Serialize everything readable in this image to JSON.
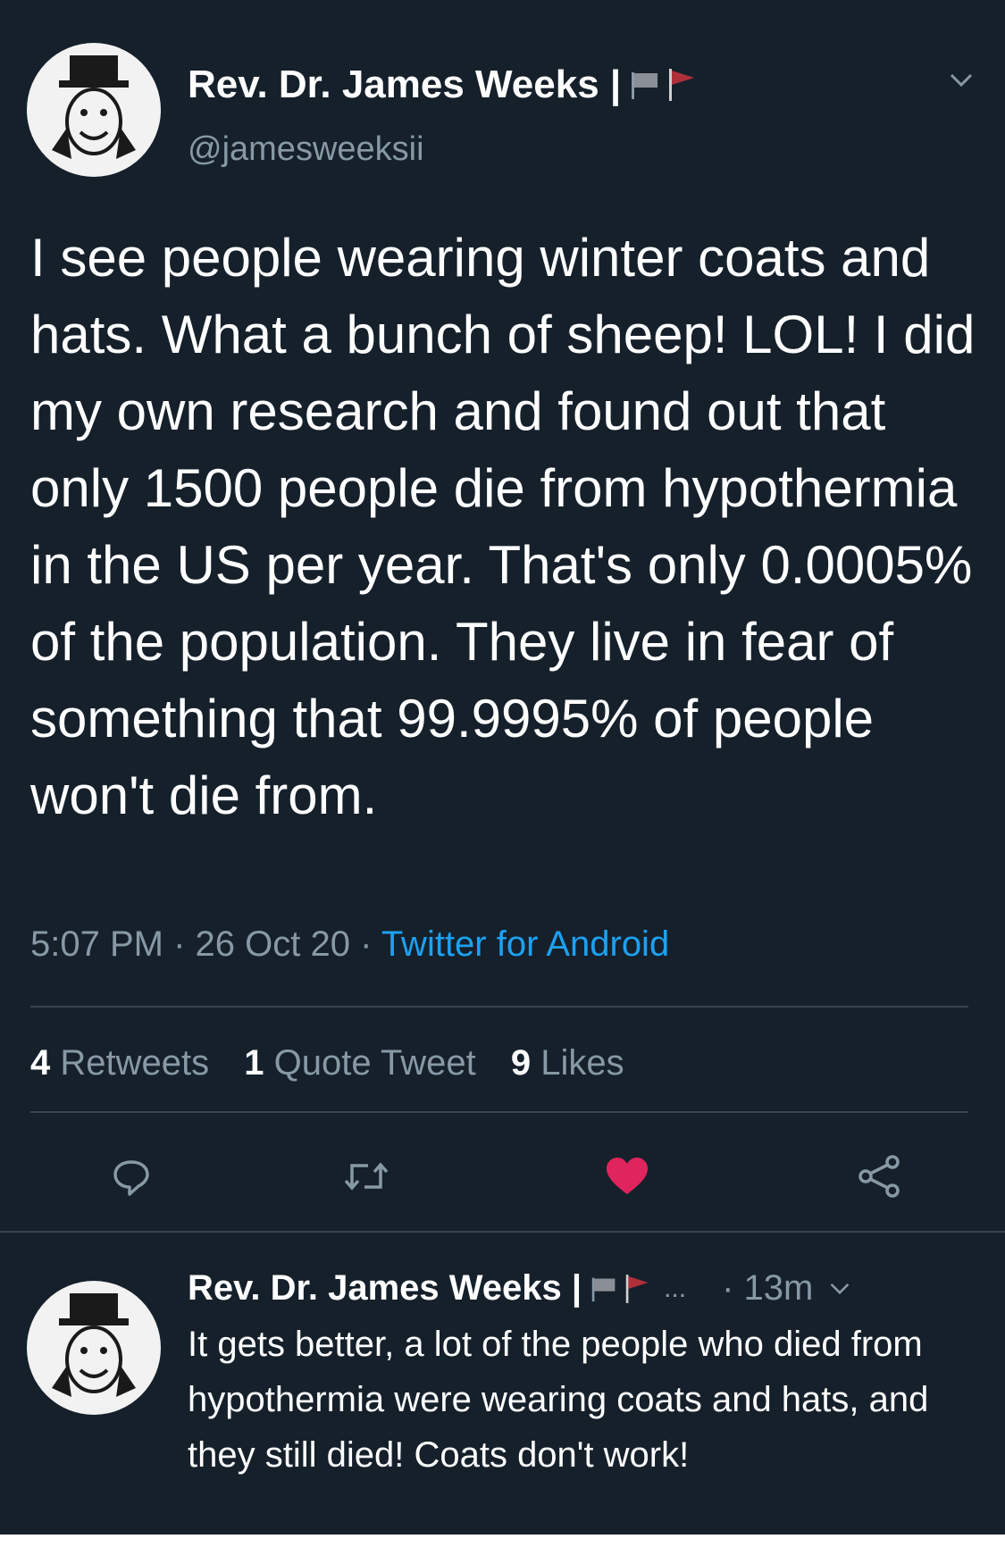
{
  "tweet": {
    "author_name": "Rev. Dr. James Weeks |",
    "handle": "@jamesweeksii",
    "text": "I see people wearing winter coats and hats. What a bunch of sheep! LOL! I did my own research and found out that only 1500 people die from hypothermia in the US per year. That's only 0.0005% of the population. They live in fear of something that 99.9995% of people won't die from.",
    "time": "5:07 PM",
    "date": "26 Oct 20",
    "source": "Twitter for Android",
    "separator": "·",
    "stats": {
      "retweets_count": "4",
      "retweets_label": "Retweets",
      "quotes_count": "1",
      "quotes_label": "Quote Tweet",
      "likes_count": "9",
      "likes_label": "Likes"
    }
  },
  "reply": {
    "author_name": "Rev. Dr. James Weeks |",
    "ellipsis": "...",
    "time": "· 13m",
    "text": "It gets better, a lot of the people who died from hypothermia were wearing coats and hats, and they still died! Coats don't work!"
  },
  "icons": {
    "reply": "reply-icon",
    "retweet": "retweet-icon",
    "like": "heart-icon",
    "share": "share-icon",
    "menu": "chevron-down-icon"
  },
  "colors": {
    "background": "#15202b",
    "secondary_text": "#8899a6",
    "link": "#1da1f2",
    "like_active": "#e0245e",
    "divider": "#38444d",
    "flag_red": "#b0303a"
  }
}
